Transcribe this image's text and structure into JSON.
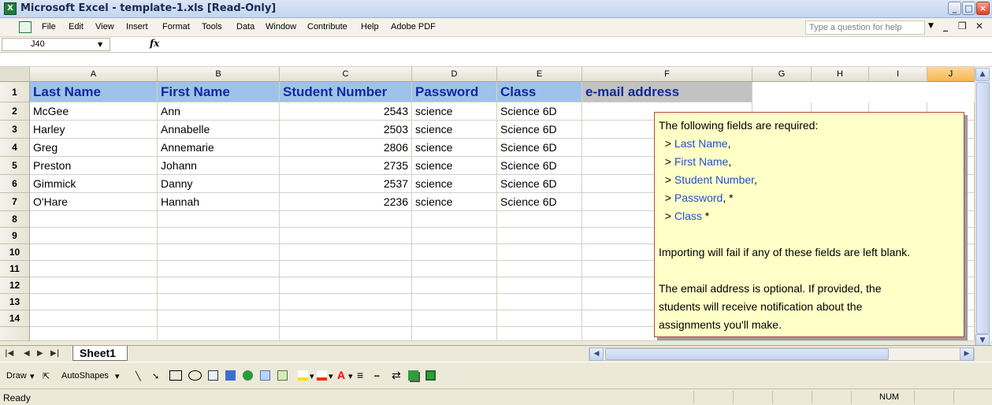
{
  "window": {
    "title": "Microsoft Excel - template-1.xls  [Read-Only]",
    "app_icon": "X"
  },
  "menu": [
    "File",
    "Edit",
    "View",
    "Insert",
    "Format",
    "Tools",
    "Data",
    "Window",
    "Contribute",
    "Help",
    "Adobe PDF"
  ],
  "help_placeholder": "Type a question for help",
  "namebox": "J40",
  "columns": [
    "A",
    "B",
    "C",
    "D",
    "E",
    "F",
    "G",
    "H",
    "I",
    "J"
  ],
  "rows": [
    "1",
    "2",
    "3",
    "4",
    "5",
    "6",
    "7",
    "8",
    "9",
    "10",
    "11",
    "12",
    "13",
    "14"
  ],
  "headers": [
    "Last Name",
    "First Name",
    "Student Number",
    "Password",
    "Class",
    "e-mail address"
  ],
  "students": [
    {
      "last": "McGee",
      "first": "Ann",
      "number": "2543",
      "password": "science",
      "class": "Science 6D"
    },
    {
      "last": "Harley",
      "first": "Annabelle",
      "number": "2503",
      "password": "science",
      "class": "Science 6D"
    },
    {
      "last": "Greg",
      "first": "Annemarie",
      "number": "2806",
      "password": "science",
      "class": "Science 6D"
    },
    {
      "last": "Preston",
      "first": "Johann",
      "number": "2735",
      "password": "science",
      "class": "Science 6D"
    },
    {
      "last": "Gimmick",
      "first": "Danny",
      "number": "2537",
      "password": "science",
      "class": "Science 6D"
    },
    {
      "last": "O'Hare",
      "first": "Hannah",
      "number": "2236",
      "password": "science",
      "class": "Science 6D"
    }
  ],
  "comment": {
    "intro": "The following fields are required:",
    "items": [
      {
        "bullet": "> ",
        "name": "Last Name",
        "suffix": ","
      },
      {
        "bullet": "> ",
        "name": "First Name",
        "suffix": ","
      },
      {
        "bullet": "> ",
        "name": "Student Number",
        "suffix": ","
      },
      {
        "bullet": "> ",
        "name": "Password",
        "suffix": ", *"
      },
      {
        "bullet": "> ",
        "name": "Class",
        "suffix": " *"
      }
    ],
    "warning": "Importing will fail if any of these fields are left blank.",
    "note1": "The email address is optional. If provided, the",
    "note2": "students will receive notification about the",
    "note3": "assignments you'll make."
  },
  "sheet_tab": "Sheet1",
  "drawing": {
    "draw": "Draw",
    "autoshapes": "AutoShapes"
  },
  "status": {
    "ready": "Ready",
    "num": "NUM"
  },
  "colors": {
    "header_fill": "#9dc3ec",
    "header_text": "#0f2a9e",
    "email_fill": "#c2c2c2",
    "comment_fill": "#ffffc8",
    "field_text": "#2250d0"
  }
}
